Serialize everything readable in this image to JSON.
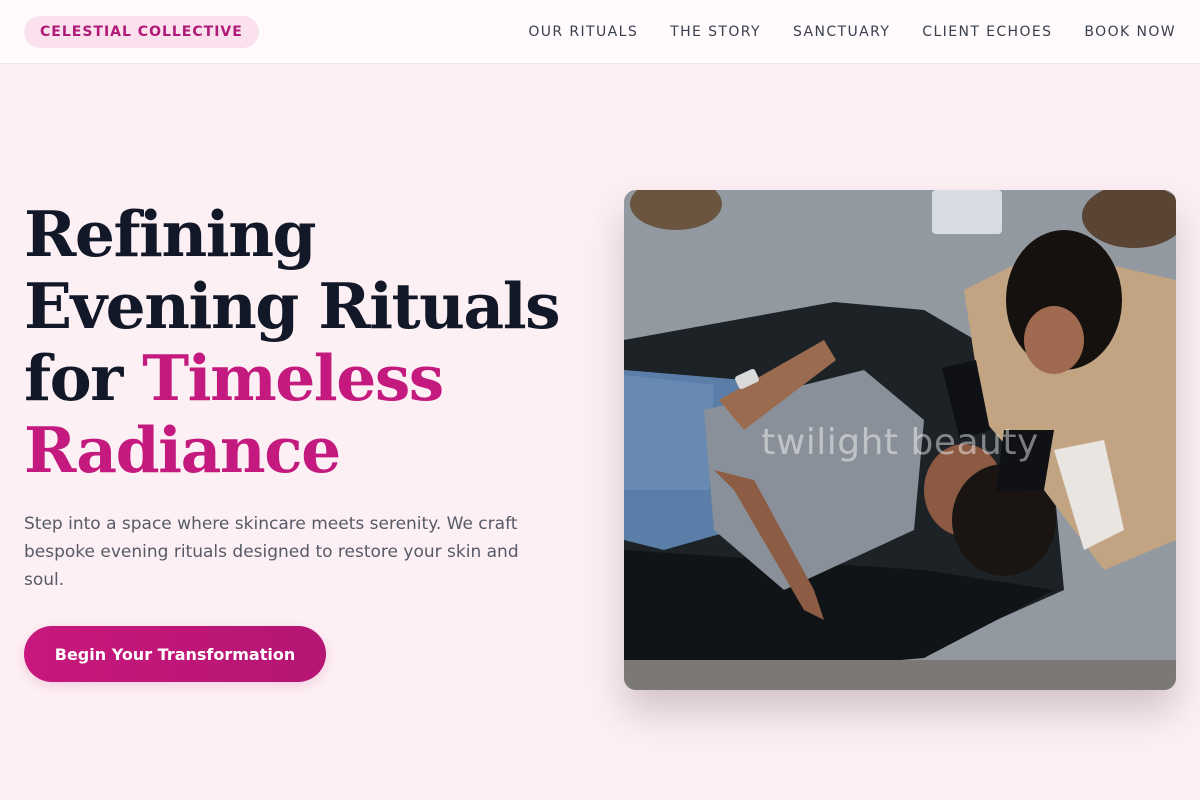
{
  "brand": {
    "name": "CELESTIAL COLLECTIVE"
  },
  "nav": {
    "items": [
      {
        "label": "OUR RITUALS"
      },
      {
        "label": "THE STORY"
      },
      {
        "label": "SANCTUARY"
      },
      {
        "label": "CLIENT ECHOES"
      },
      {
        "label": "BOOK NOW"
      }
    ]
  },
  "hero": {
    "title_line1": "Refining",
    "title_line2": "Evening Rituals",
    "title_line3_prefix": "for ",
    "title_accent_1": "Timeless",
    "title_accent_2": "Radiance",
    "subtitle": "Step into a space where skincare meets serenity. We craft bespoke evening rituals designed to restore your skin and soul.",
    "cta_label": "Begin Your Transformation",
    "image_watermark": "twilight beauty"
  },
  "colors": {
    "accent": "#c4197e",
    "page_background": "#fdf0f4",
    "heading": "#121828"
  }
}
